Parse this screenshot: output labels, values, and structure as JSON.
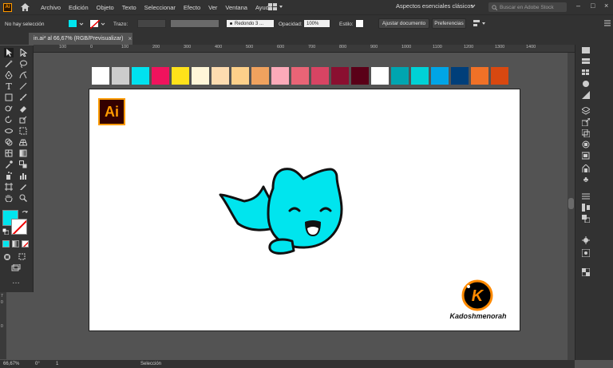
{
  "menubar": {
    "app_logo": "Ai",
    "items": [
      "Archivo",
      "Edición",
      "Objeto",
      "Texto",
      "Seleccionar",
      "Efecto",
      "Ver",
      "Ventana",
      "Ayuda"
    ],
    "workspace": "Aspectos esenciales clásicos",
    "search_placeholder": "Buscar en Adobe Stock"
  },
  "controlbar": {
    "selection": "No hay selección",
    "stroke_label": "Trazo:",
    "brush": "Redondo 3 ...",
    "opacity_label": "Opacidad:",
    "opacity_value": "100%",
    "style_label": "Estilo:",
    "adjust_button": "Ajustar documento",
    "prefs_button": "Preferencias"
  },
  "tab": {
    "title": "in.ai* al 66,67% (RGB/Previsualizar)",
    "close": "×"
  },
  "ruler": {
    "top_labels": [
      "100",
      "0",
      "100",
      "200",
      "300",
      "400",
      "500",
      "600",
      "700",
      "800",
      "900",
      "1000",
      "1100",
      "1200",
      "1300",
      "1400"
    ],
    "left_labels": [
      "7",
      "0",
      "0"
    ]
  },
  "swatches": [
    "#ffffff",
    "#cccccc",
    "#00e2ef",
    "#f0135d",
    "#ffe21a",
    "#fff6d8",
    "#fddcb0",
    "#fdd08a",
    "#f0a25e",
    "#fcaab9",
    "#e96476",
    "#d84463",
    "#8a0f30",
    "#5a0018",
    "#ffffff",
    "#00a5b0",
    "#00d2d6",
    "#00a5e6",
    "#003f7a",
    "#f07127",
    "#d84810"
  ],
  "artboard": {
    "ai_logo": "Ai",
    "brand_logo_letter": "K",
    "brand": "Kadoshmenorah"
  },
  "colors": {
    "fill": "#00e5ee",
    "accent": "#ff9a00"
  },
  "statusbar": {
    "zoom": "66,67%",
    "angle": "0°",
    "artboard_num": "1",
    "tool": "Selección"
  }
}
